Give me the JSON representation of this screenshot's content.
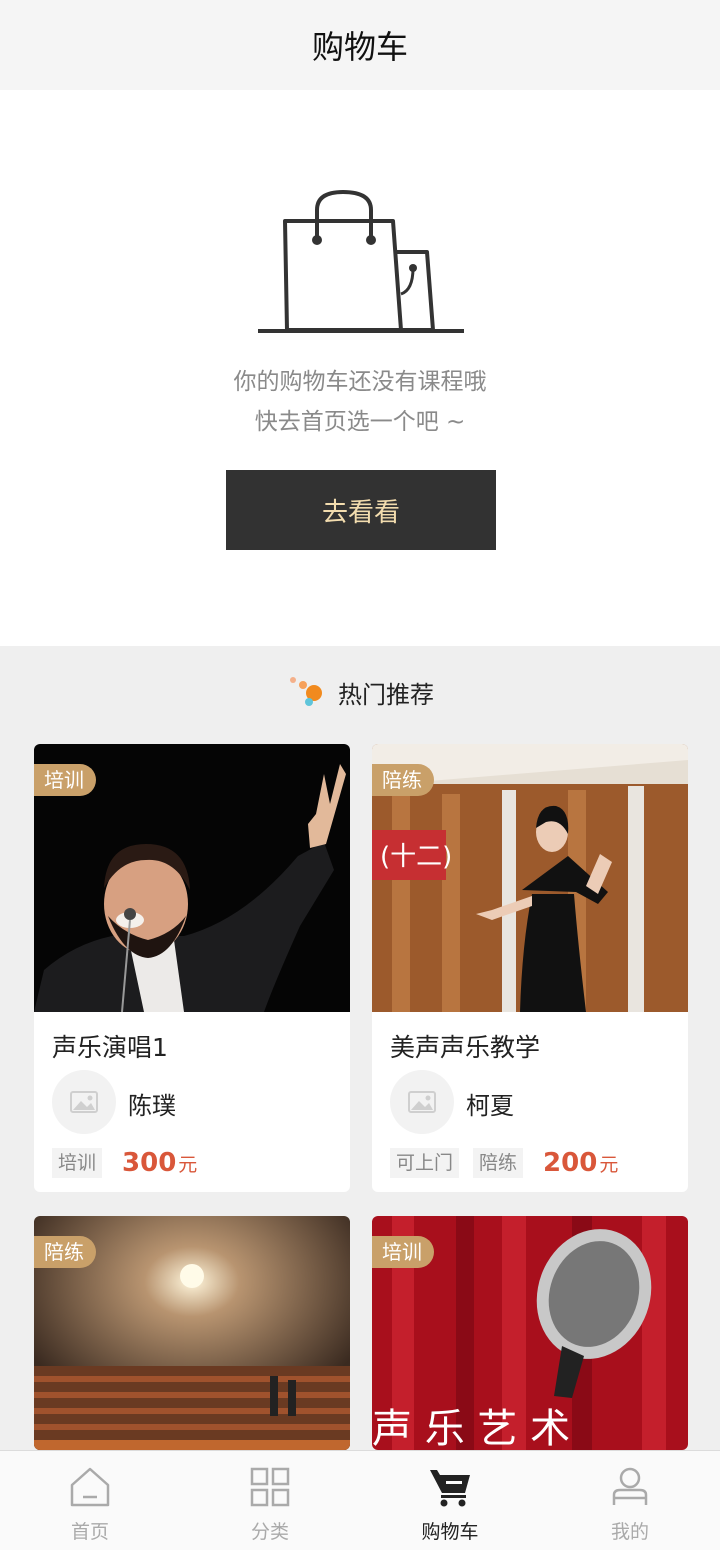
{
  "navbar": {
    "title": "购物车"
  },
  "empty_cart": {
    "line1": "你的购物车还没有课程哦",
    "line2": "快去首页选一个吧 ~",
    "button_label": "去看看"
  },
  "recommend": {
    "title": "热门推荐",
    "cards": [
      {
        "badge": "培训",
        "title": "声乐演唱1",
        "teacher": "陈璞",
        "tags": [
          "培训"
        ],
        "price": "300",
        "unit": "元"
      },
      {
        "badge": "陪练",
        "title": "美声声乐教学",
        "teacher": "柯夏",
        "tags": [
          "可上门",
          "陪练"
        ],
        "price": "200",
        "unit": "元"
      },
      {
        "badge": "陪练"
      },
      {
        "badge": "培训",
        "image_text": "声 乐 艺 术"
      }
    ]
  },
  "tabbar": {
    "items": [
      {
        "label": "首页",
        "icon": "home-icon",
        "active": false
      },
      {
        "label": "分类",
        "icon": "category-icon",
        "active": false
      },
      {
        "label": "购物车",
        "icon": "cart-icon",
        "active": true
      },
      {
        "label": "我的",
        "icon": "profile-icon",
        "active": false
      }
    ]
  },
  "colors": {
    "accent_gold": "#c9a069",
    "button_dark": "#323232",
    "button_text": "#f2dcae",
    "price_red": "#d9573a"
  }
}
